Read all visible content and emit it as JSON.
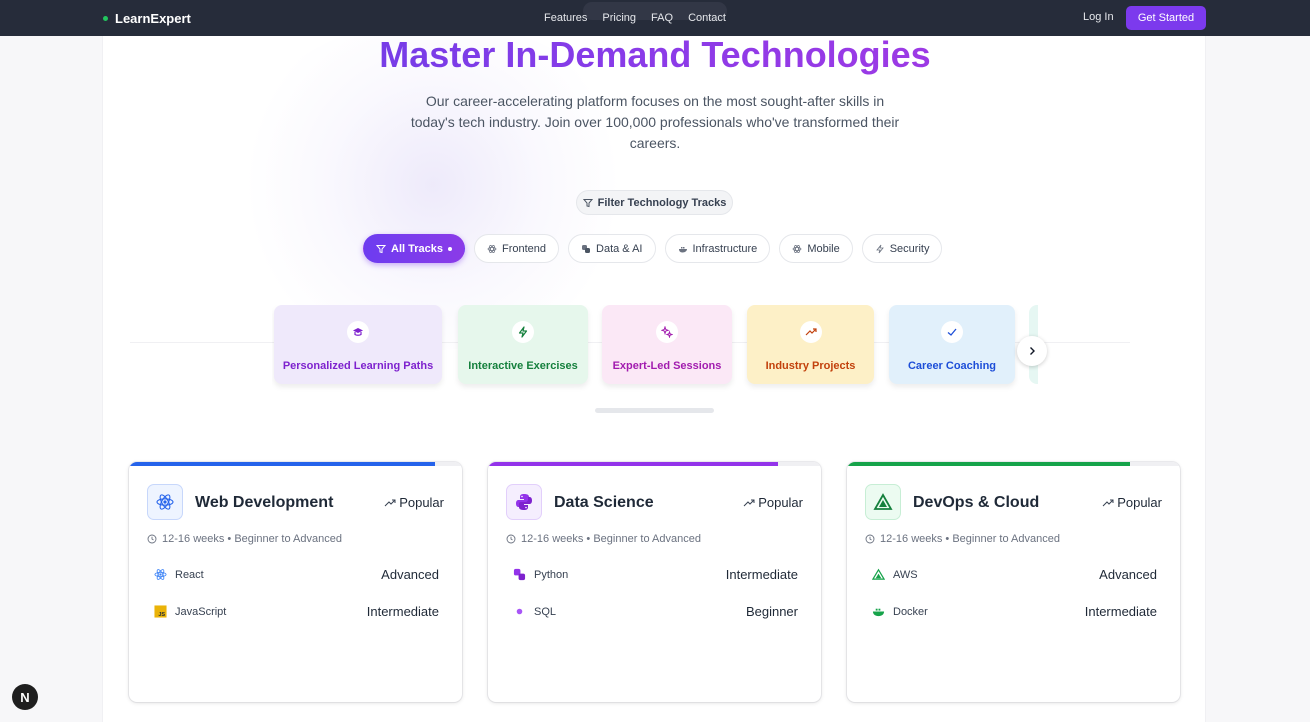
{
  "nav": {
    "brand": "LearnExpert",
    "links": [
      "Features",
      "Pricing",
      "FAQ",
      "Contact"
    ],
    "login": "Log In",
    "cta": "Get Started"
  },
  "hero": {
    "title": "Master In-Demand Technologies",
    "subtitle": "Our career-accelerating platform focuses on the most sought-after skills in today's tech industry. Join over 100,000 professionals who've transformed their careers.",
    "filter_label": "Filter Technology Tracks"
  },
  "tracks": [
    "All Tracks",
    "Frontend",
    "Data & AI",
    "Infrastructure",
    "Mobile",
    "Security"
  ],
  "features": [
    {
      "label": "Personalized Learning Paths",
      "icon": "graduation-cap-icon",
      "color": "#7e22ce",
      "bg": "#efe9fb"
    },
    {
      "label": "Interactive Exercises",
      "icon": "lightning-icon",
      "color": "#15803d",
      "bg": "#e6f7ec"
    },
    {
      "label": "Expert-Led Sessions",
      "icon": "sparkles-icon",
      "color": "#a21caf",
      "bg": "#fbe8f6"
    },
    {
      "label": "Industry Projects",
      "icon": "trending-up-icon",
      "color": "#c2410c",
      "bg": "#fdf0c7"
    },
    {
      "label": "Career Coaching",
      "icon": "check-icon",
      "color": "#1d4ed8",
      "bg": "#e1f0fb"
    }
  ],
  "cards": [
    {
      "title": "Web Development",
      "badge": "Popular",
      "meta": "12-16 weeks • Beginner to Advanced",
      "progress": 0.92,
      "accent": "#2563eb",
      "icon": "react-icon",
      "skills": [
        {
          "name": "React",
          "level": "Advanced",
          "icon": "react-icon"
        },
        {
          "name": "JavaScript",
          "level": "Intermediate",
          "icon": "javascript-icon"
        }
      ]
    },
    {
      "title": "Data Science",
      "badge": "Popular",
      "meta": "12-16 weeks • Beginner to Advanced",
      "progress": 0.87,
      "accent": "#9333ea",
      "icon": "python-icon",
      "skills": [
        {
          "name": "Python",
          "level": "Intermediate",
          "icon": "python-icon"
        },
        {
          "name": "SQL",
          "level": "Beginner",
          "icon": "dot-icon"
        }
      ]
    },
    {
      "title": "DevOps & Cloud",
      "badge": "Popular",
      "meta": "12-16 weeks • Beginner to Advanced",
      "progress": 0.85,
      "accent": "#16a34a",
      "icon": "aws-icon",
      "skills": [
        {
          "name": "AWS",
          "level": "Advanced",
          "icon": "aws-icon"
        },
        {
          "name": "Docker",
          "level": "Intermediate",
          "icon": "docker-icon"
        }
      ]
    }
  ]
}
